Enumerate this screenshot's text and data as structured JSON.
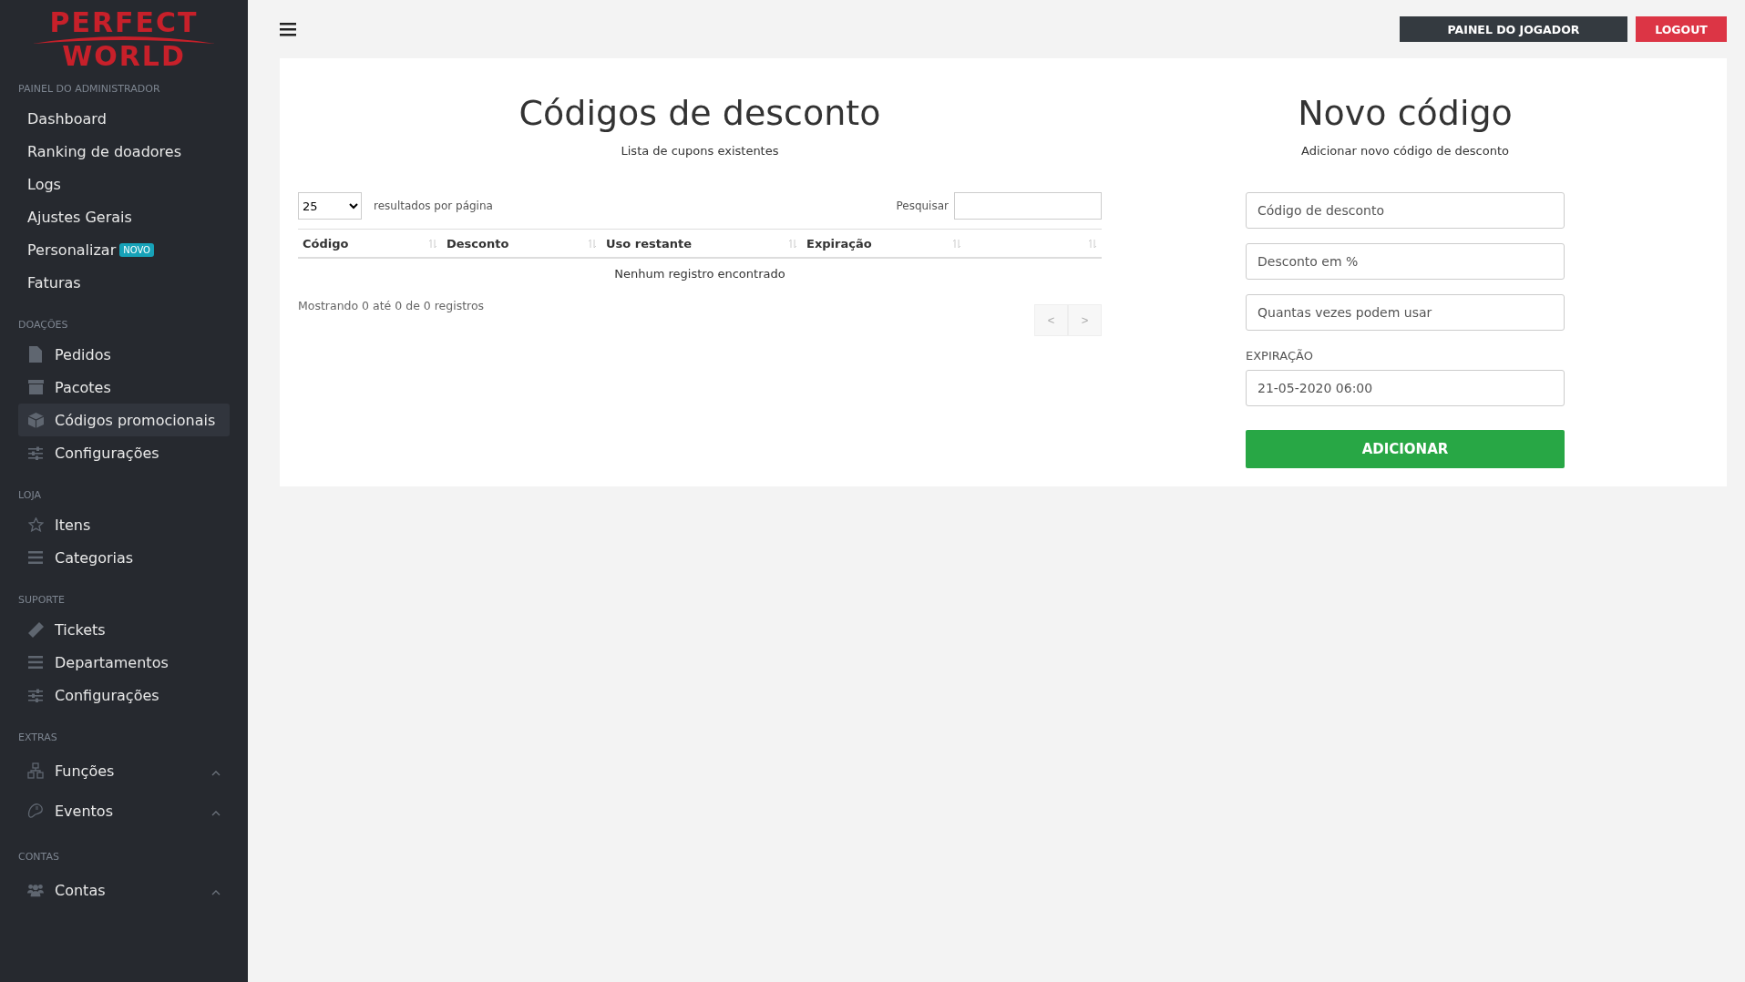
{
  "logo": {
    "line_1": "PERFECT",
    "line_2": "WORLD"
  },
  "sidebar": {
    "sections": [
      {
        "title": "PAINEL DO ADMINISTRADOR",
        "items": [
          {
            "label": "Dashboard",
            "selected": false
          },
          {
            "label": "Ranking de doadores",
            "selected": false
          },
          {
            "label": "Logs",
            "selected": false
          },
          {
            "label": "Ajustes Gerais",
            "selected": false
          },
          {
            "label": "Personalizar",
            "badge": "NOVO",
            "selected": false
          },
          {
            "label": "Faturas",
            "selected": false
          }
        ]
      },
      {
        "title": "DOAÇÕES",
        "items": [
          {
            "label": "Pedidos",
            "selected": false
          },
          {
            "label": "Pacotes",
            "selected": false
          },
          {
            "label": "Códigos promocionais",
            "selected": true
          },
          {
            "label": "Configurações",
            "selected": false
          }
        ]
      },
      {
        "title": "LOJA",
        "items": [
          {
            "label": "Itens",
            "selected": false
          },
          {
            "label": "Categorias",
            "selected": false
          }
        ]
      },
      {
        "title": "SUPORTE",
        "items": [
          {
            "label": "Tickets",
            "selected": false
          },
          {
            "label": "Departamentos",
            "selected": false
          },
          {
            "label": "Configurações",
            "selected": false
          }
        ]
      },
      {
        "title": "EXTRAS",
        "items": [
          {
            "label": "Funções",
            "selected": false,
            "expanded": false
          },
          {
            "label": "Eventos",
            "selected": false,
            "expanded": false
          }
        ]
      },
      {
        "title": "CONTAS",
        "items": [
          {
            "label": "Contas",
            "selected": false,
            "expanded": false
          }
        ]
      }
    ]
  },
  "topbar": {
    "buttons": [
      {
        "label": "PAINEL DO JOGADOR",
        "kind": "dark"
      },
      {
        "label": "LOGOUT",
        "kind": "danger"
      }
    ]
  },
  "list_panel": {
    "title": "Códigos de desconto",
    "subtitle": "Lista de cupons existentes",
    "page_size": "25",
    "page_size_label": "resultados por página",
    "search_label": "Pesquisar",
    "columns": [
      {
        "label": "Código"
      },
      {
        "label": "Desconto"
      },
      {
        "label": "Uso restante"
      },
      {
        "label": "Expiração"
      }
    ],
    "empty_message": "Nenhum registro encontrado",
    "info": "Mostrando 0 até 0 de 0 registros",
    "pager": [
      {
        "label": "<",
        "disabled": true
      },
      {
        "label": ">",
        "disabled": true
      }
    ]
  },
  "form_panel": {
    "title": "Novo código",
    "subtitle": "Adicionar novo código de desconto",
    "fields": [
      {
        "placeholder": "Código de desconto"
      },
      {
        "placeholder": "Desconto em %"
      },
      {
        "placeholder": "Quantas vezes podem usar"
      },
      {
        "label": "EXPIRAÇÃO",
        "value": "21-05-2020 06:00"
      }
    ],
    "submit": "ADICIONAR"
  }
}
